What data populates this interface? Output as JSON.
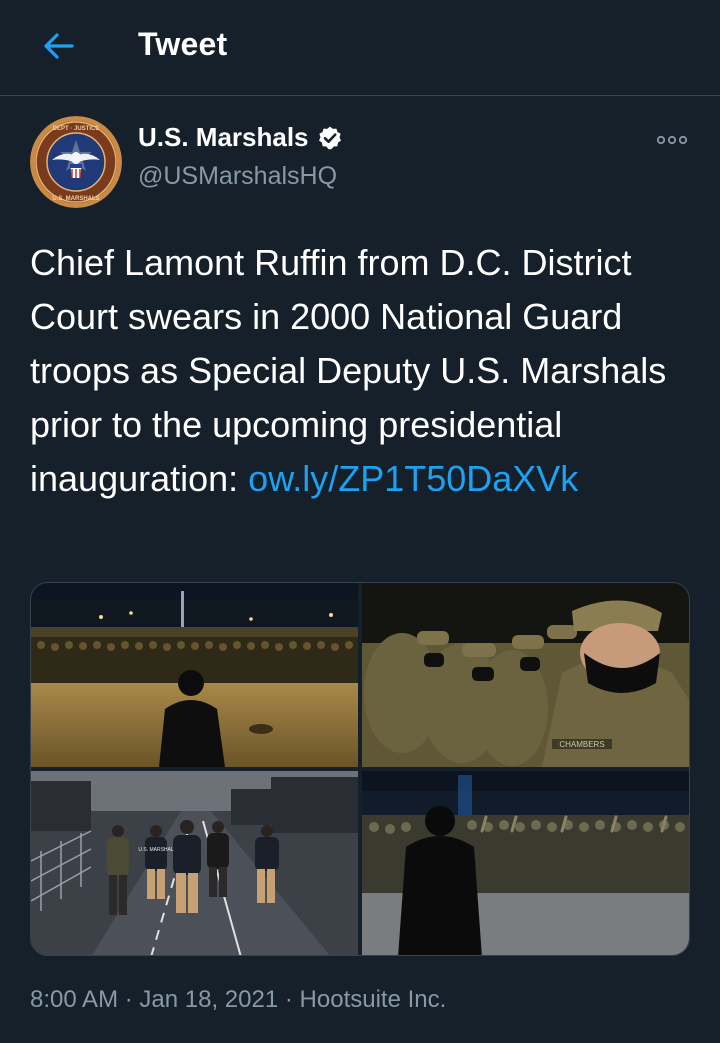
{
  "header": {
    "title": "Tweet",
    "back_icon": "arrow-left-icon"
  },
  "author": {
    "display_name": "U.S. Marshals",
    "handle": "@USMarshalsHQ",
    "verified_icon": "verified-badge-icon",
    "avatar_icon": "us-marshals-seal-icon",
    "seal_text": "DEPARTMENT OF JUSTICE UNITED STATES MARSHAL"
  },
  "tweet": {
    "text": "Chief Lamont Ruffin from D.C. District Court swears in 2000 National Guard troops as Special Deputy U.S. Marshals prior to the upcoming presidential inauguration: ",
    "link": "ow.ly/ZP1T50DaXVk",
    "photos": [
      {
        "description_icon": "photo-troops-night-street"
      },
      {
        "description_icon": "photo-soldiers-masked-closeup"
      },
      {
        "description_icon": "photo-marshals-walking-street"
      },
      {
        "description_icon": "photo-troops-swearing-in"
      }
    ],
    "photo_texts": {
      "nametape": "CHAMBERS",
      "jacket_text": "U.S. MARSHAL"
    }
  },
  "meta": {
    "time": "8:00 AM",
    "separator": "·",
    "date": "Jan 18, 2021",
    "source": "Hootsuite Inc."
  },
  "colors": {
    "background": "#15202b",
    "border": "#38444d",
    "accent": "#1da1f2",
    "secondary_text": "#8899a6"
  }
}
